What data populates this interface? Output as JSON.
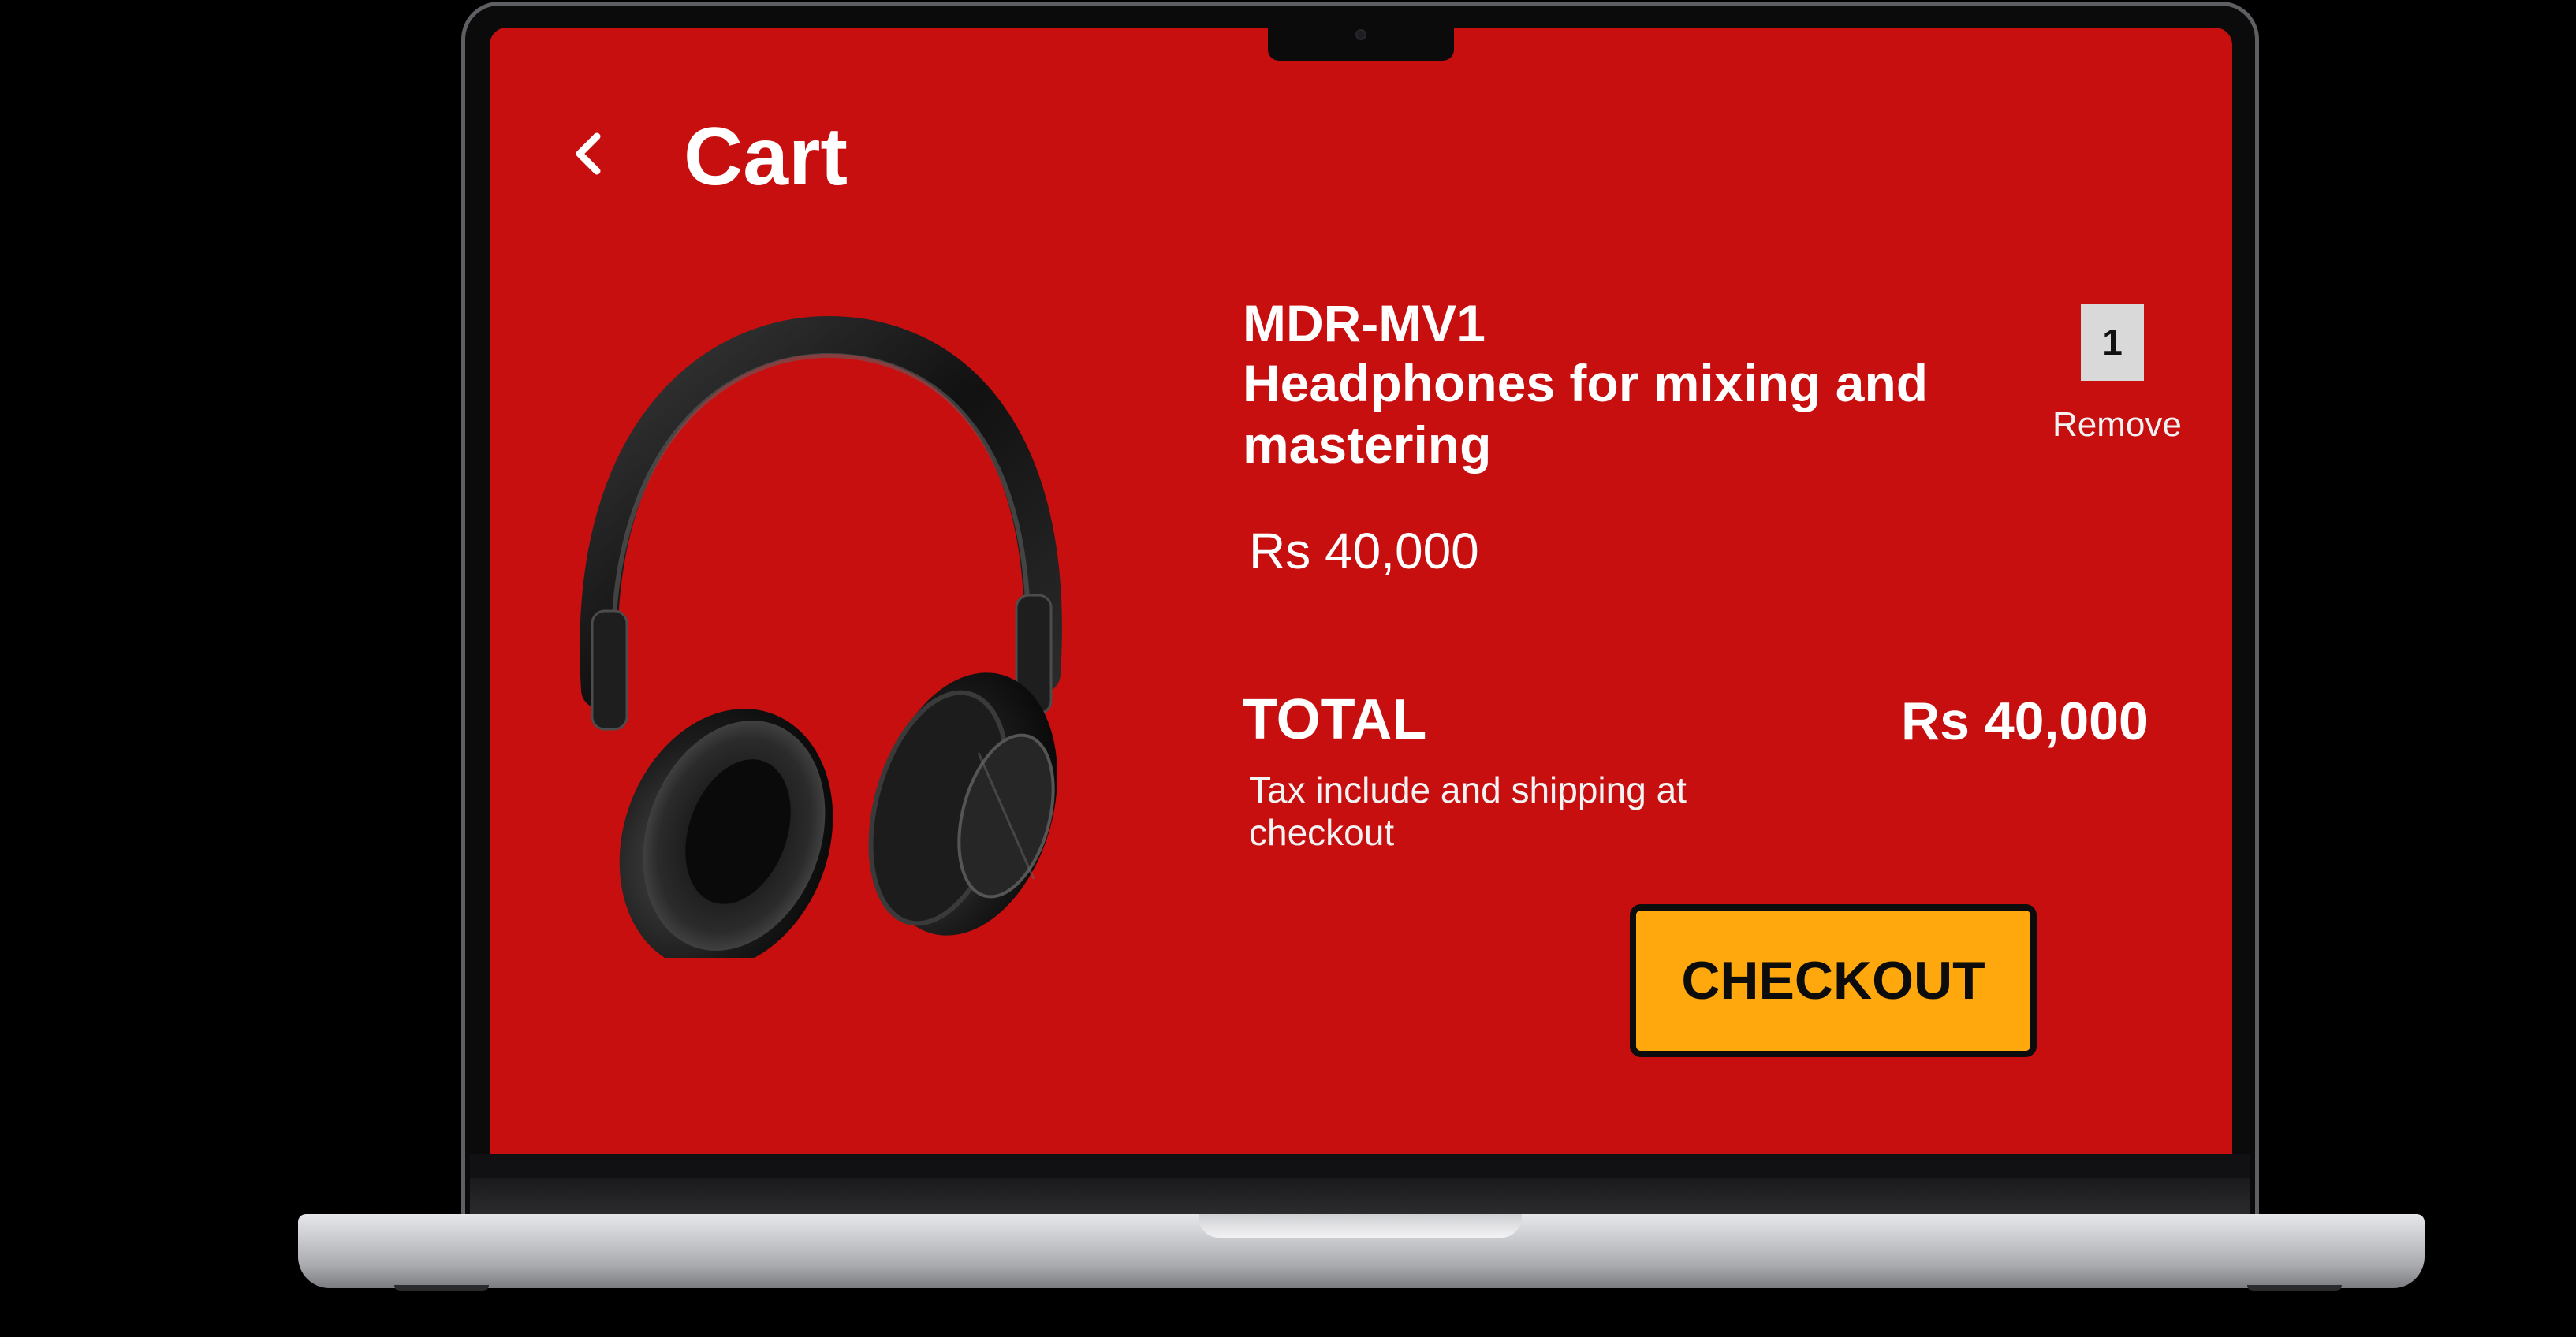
{
  "header": {
    "title": "Cart",
    "back_icon": "chevron-left-icon"
  },
  "cart_item": {
    "image_alt": "headphones",
    "code": "MDR-MV1",
    "description": "Headphones for mixing and mastering",
    "price": "Rs 40,000",
    "quantity": "1",
    "remove_label": "Remove"
  },
  "summary": {
    "total_label": "TOTAL",
    "total_value": "Rs 40,000",
    "tax_note": "Tax include and shipping at checkout"
  },
  "actions": {
    "checkout_label": "CHECKOUT"
  },
  "colors": {
    "screen_bg": "#c80f0f",
    "checkout_bg": "#fea80d",
    "text": "#ffffff"
  }
}
